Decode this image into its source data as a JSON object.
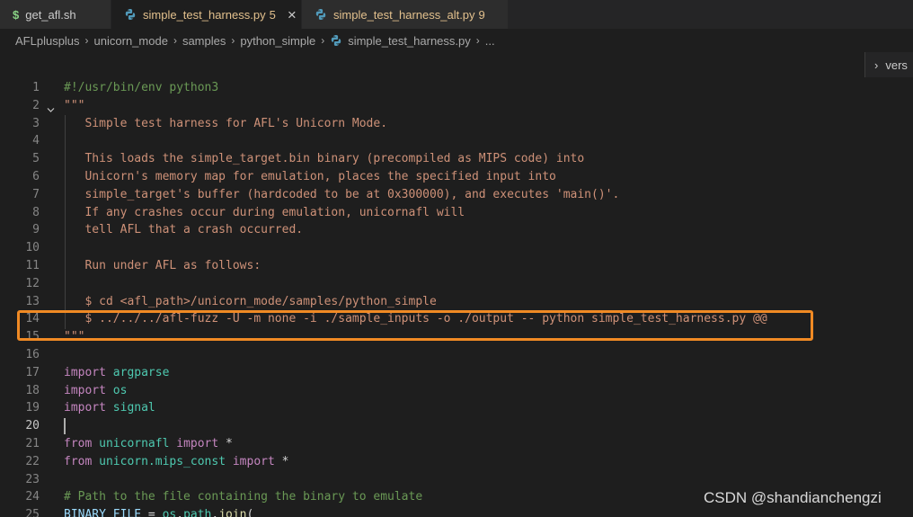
{
  "tabs": [
    {
      "icon": "shell-dollar-icon",
      "glyph": "$",
      "label": "get_afl.sh",
      "badge": "",
      "modified": false,
      "active": false,
      "closable": false
    },
    {
      "icon": "python-icon",
      "glyph": "",
      "label": "simple_test_harness.py",
      "badge": "5",
      "modified": true,
      "active": true,
      "closable": true
    },
    {
      "icon": "python-icon",
      "glyph": "",
      "label": "simple_test_harness_alt.py",
      "badge": "9",
      "modified": true,
      "active": false,
      "closable": false
    }
  ],
  "tab_close_glyph": "×",
  "breadcrumb": [
    "AFLplusplus",
    "unicorn_mode",
    "samples",
    "python_simple",
    "simple_test_harness.py",
    "..."
  ],
  "breadcrumb_sep": "›",
  "peek": {
    "chevron": "›",
    "text": "vers"
  },
  "current_line": 20,
  "lines": [
    {
      "n": "1",
      "tokens": [
        {
          "c": "cmt",
          "t": "#!/usr/bin/env python3"
        }
      ]
    },
    {
      "n": "2",
      "fold": true,
      "tokens": [
        {
          "c": "str",
          "t": "\"\"\""
        }
      ]
    },
    {
      "n": "3",
      "tokens": [
        {
          "c": "str",
          "t": "   Simple test harness for AFL's Unicorn Mode."
        }
      ]
    },
    {
      "n": "4",
      "tokens": []
    },
    {
      "n": "5",
      "tokens": [
        {
          "c": "str",
          "t": "   This loads the simple_target.bin binary (precompiled as MIPS code) into"
        }
      ]
    },
    {
      "n": "6",
      "tokens": [
        {
          "c": "str",
          "t": "   Unicorn's memory map for emulation, places the specified input into"
        }
      ]
    },
    {
      "n": "7",
      "tokens": [
        {
          "c": "str",
          "t": "   simple_target's buffer (hardcoded to be at 0x300000), and executes 'main()'."
        }
      ]
    },
    {
      "n": "8",
      "tokens": [
        {
          "c": "str",
          "t": "   If any crashes occur during emulation, unicornafl will"
        }
      ]
    },
    {
      "n": "9",
      "tokens": [
        {
          "c": "str",
          "t": "   tell AFL that a crash occurred."
        }
      ]
    },
    {
      "n": "10",
      "tokens": []
    },
    {
      "n": "11",
      "tokens": [
        {
          "c": "str",
          "t": "   Run under AFL as follows:"
        }
      ]
    },
    {
      "n": "12",
      "tokens": []
    },
    {
      "n": "13",
      "tokens": [
        {
          "c": "str",
          "t": "   $ cd <afl_path>/unicorn_mode/samples/python_simple"
        }
      ]
    },
    {
      "n": "14",
      "tokens": [
        {
          "c": "str",
          "t": "   $ ../../../afl-fuzz -U -m none -i ./sample_inputs -o ./output -- python simple_test_harness.py @@"
        }
      ]
    },
    {
      "n": "15",
      "tokens": [
        {
          "c": "str",
          "t": "\"\"\""
        }
      ]
    },
    {
      "n": "16",
      "tokens": []
    },
    {
      "n": "17",
      "tokens": [
        {
          "c": "kw",
          "t": "import"
        },
        {
          "c": "plain",
          "t": " "
        },
        {
          "c": "mod",
          "t": "argparse"
        }
      ]
    },
    {
      "n": "18",
      "tokens": [
        {
          "c": "kw",
          "t": "import"
        },
        {
          "c": "plain",
          "t": " "
        },
        {
          "c": "mod",
          "t": "os"
        }
      ]
    },
    {
      "n": "19",
      "tokens": [
        {
          "c": "kw",
          "t": "import"
        },
        {
          "c": "plain",
          "t": " "
        },
        {
          "c": "mod",
          "t": "signal"
        }
      ]
    },
    {
      "n": "20",
      "tokens": []
    },
    {
      "n": "21",
      "tokens": [
        {
          "c": "kw",
          "t": "from"
        },
        {
          "c": "plain",
          "t": " "
        },
        {
          "c": "mod",
          "t": "unicornafl"
        },
        {
          "c": "plain",
          "t": " "
        },
        {
          "c": "kw",
          "t": "import"
        },
        {
          "c": "plain",
          "t": " *"
        }
      ]
    },
    {
      "n": "22",
      "tokens": [
        {
          "c": "kw",
          "t": "from"
        },
        {
          "c": "plain",
          "t": " "
        },
        {
          "c": "mod",
          "t": "unicorn.mips_const"
        },
        {
          "c": "plain",
          "t": " "
        },
        {
          "c": "kw",
          "t": "import"
        },
        {
          "c": "plain",
          "t": " *"
        }
      ]
    },
    {
      "n": "23",
      "tokens": []
    },
    {
      "n": "24",
      "tokens": [
        {
          "c": "cmt",
          "t": "# Path to the file containing the binary to emulate"
        }
      ]
    },
    {
      "n": "25",
      "fold": true,
      "tokens": [
        {
          "c": "var",
          "t": "BINARY_FILE"
        },
        {
          "c": "plain",
          "t": " = "
        },
        {
          "c": "mod",
          "t": "os"
        },
        {
          "c": "plain",
          "t": "."
        },
        {
          "c": "mod",
          "t": "path"
        },
        {
          "c": "plain",
          "t": "."
        },
        {
          "c": "fn",
          "t": "join"
        },
        {
          "c": "plain",
          "t": "("
        }
      ]
    }
  ],
  "watermark": "CSDN @shandianchengzi"
}
